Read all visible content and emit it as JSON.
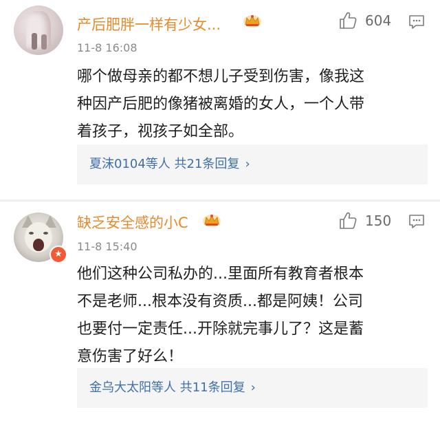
{
  "comments": [
    {
      "username": "产后肥胖一样有少女...",
      "time": "11-8 16:08",
      "likes": "604",
      "text_lines": [
        "哪个做母亲的都不想儿子受到伤害，像我这",
        "种因产后肥的像猪被离婚的女人，一个人带",
        "着孩子，视孩子如全部。"
      ],
      "replies_text": "夏沫0104等人  共21条回复",
      "replies_chevron": "›"
    },
    {
      "username": "缺乏安全感的小C",
      "time": "11-8 15:40",
      "likes": "150",
      "text_lines": [
        "他们这种公司私办的...里面所有教育者根本",
        "不是老师...根本没有资质...都是阿姨！公司",
        "也要付一定责任...开除就完事儿了？这是蓄",
        "意伤害了好么！"
      ],
      "replies_text": "金乌大太阳等人  共11条回复",
      "replies_chevron": "›",
      "badge": "★"
    }
  ],
  "colors": {
    "username": "#e88a2c",
    "reply_link": "#3f6fa8",
    "timestamp": "#8a8a8a",
    "crown": "#f0a21d",
    "verified_badge": "#f15a34"
  },
  "icons": [
    "crown-icon",
    "thumbs-up-icon",
    "reply-comment-icon",
    "chevron-right-icon",
    "verified-badge-icon"
  ]
}
